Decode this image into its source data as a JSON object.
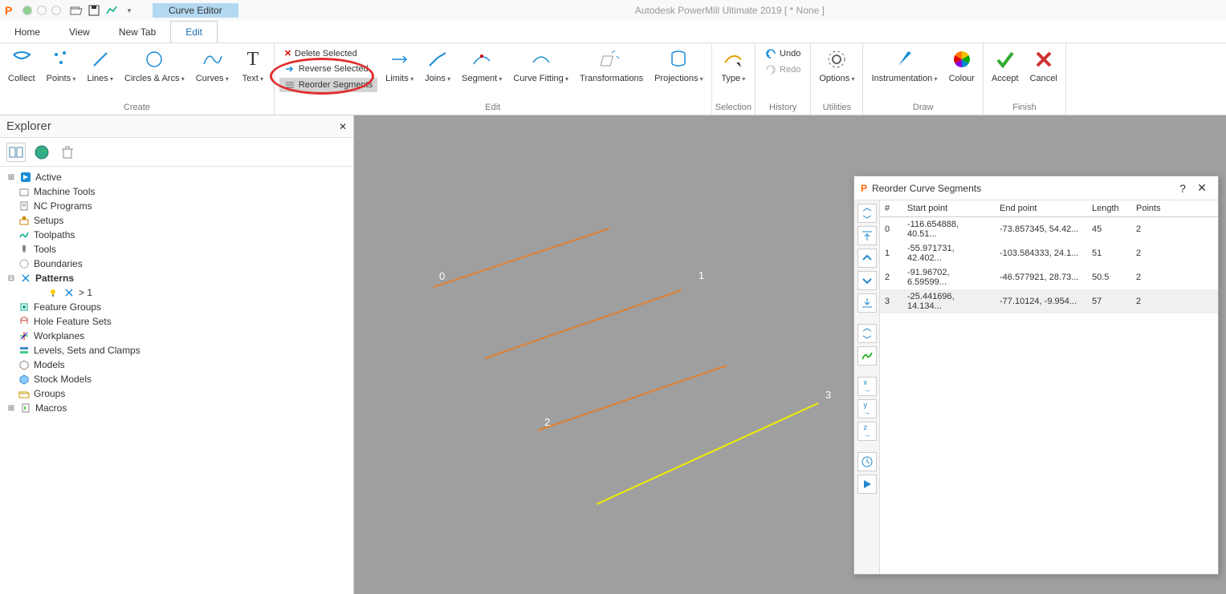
{
  "titlebar": {
    "context_tab": "Curve Editor",
    "title": "Autodesk PowerMill Ultimate 2019   [ * None ]"
  },
  "tabs": [
    "Home",
    "View",
    "New Tab",
    "Edit"
  ],
  "ribbon": {
    "create": {
      "label": "Create",
      "items": [
        "Collect",
        "Points",
        "Lines",
        "Circles & Arcs",
        "Curves",
        "Text"
      ]
    },
    "edit_small": {
      "delete": "Delete Selected",
      "reverse": "Reverse Selected",
      "reorder": "Reorder Segments"
    },
    "edit_large": [
      "Limits",
      "Joins",
      "Segment",
      "Curve Fitting",
      "Transformations",
      "Projections"
    ],
    "edit_label": "Edit",
    "selection": {
      "label": "Selection",
      "item": "Type"
    },
    "history": {
      "label": "History",
      "undo": "Undo",
      "redo": "Redo"
    },
    "utilities": {
      "label": "Utilities",
      "item": "Options"
    },
    "draw": {
      "label": "Draw",
      "items": [
        "Instrumentation",
        "Colour"
      ]
    },
    "finish": {
      "label": "Finish",
      "items": [
        "Accept",
        "Cancel"
      ]
    }
  },
  "explorer": {
    "title": "Explorer",
    "tree": [
      {
        "label": "Active",
        "expander": "⊞",
        "icon": "active"
      },
      {
        "label": "Machine Tools",
        "icon": "machine"
      },
      {
        "label": "NC Programs",
        "icon": "nc"
      },
      {
        "label": "Setups",
        "icon": "setups"
      },
      {
        "label": "Toolpaths",
        "icon": "toolpaths"
      },
      {
        "label": "Tools",
        "icon": "tools"
      },
      {
        "label": "Boundaries",
        "icon": "boundaries"
      },
      {
        "label": "Patterns",
        "expander": "⊟",
        "icon": "patterns",
        "bold": true
      },
      {
        "label": "> 1",
        "indent": 2,
        "icon": "pattern-item",
        "prefix_icon": "bulb"
      },
      {
        "label": "Feature Groups",
        "icon": "feature"
      },
      {
        "label": "Hole Feature Sets",
        "icon": "hole"
      },
      {
        "label": "Workplanes",
        "icon": "workplane"
      },
      {
        "label": "Levels, Sets and Clamps",
        "icon": "levels"
      },
      {
        "label": "Models",
        "icon": "models"
      },
      {
        "label": "Stock Models",
        "icon": "stock"
      },
      {
        "label": "Groups",
        "icon": "groups"
      },
      {
        "label": "Macros",
        "expander": "⊞",
        "icon": "macros"
      }
    ]
  },
  "viewport": {
    "labels": [
      "0",
      "1",
      "2",
      "3"
    ]
  },
  "dialog": {
    "title": "Reorder Curve Segments",
    "help": "?",
    "headers": [
      "#",
      "Start point",
      "End point",
      "Length",
      "Points"
    ],
    "rows": [
      [
        "0",
        "-116.654888, 40.51...",
        "-73.857345, 54.42...",
        "45",
        "2"
      ],
      [
        "1",
        "-55.971731, 42.402...",
        "-103.584333, 24.1...",
        "51",
        "2"
      ],
      [
        "2",
        "-91.96702, 6.59599...",
        "-46.577921, 28.73...",
        "50.5",
        "2"
      ],
      [
        "3",
        "-25.441696, 14.134...",
        "-77.10124, -9.954...",
        "57",
        "2"
      ]
    ]
  }
}
